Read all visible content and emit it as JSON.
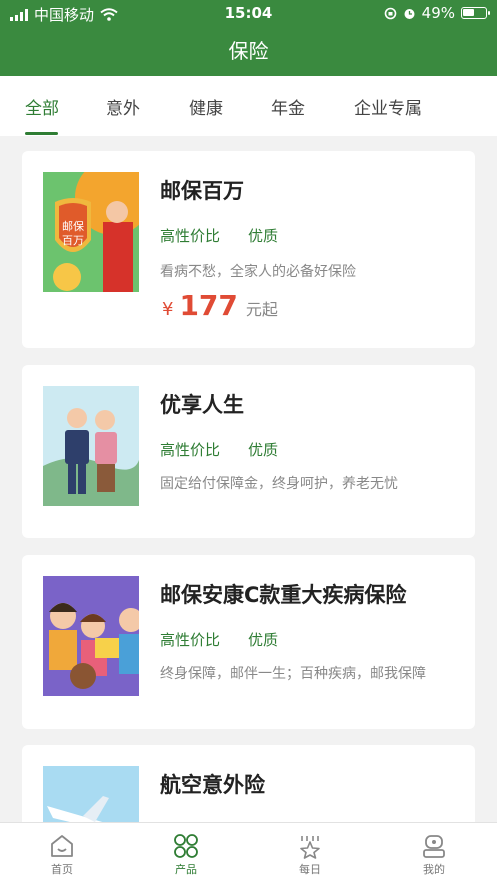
{
  "status": {
    "carrier": "中国移动",
    "time": "15:04",
    "battery": "49%"
  },
  "header": {
    "title": "保险"
  },
  "tabs": [
    "全部",
    "意外",
    "健康",
    "年金",
    "企业专属"
  ],
  "products": [
    {
      "title": "邮保百万",
      "tags": [
        "高性价比",
        "优质"
      ],
      "desc": "看病不愁，全家人的必备好保险",
      "price_currency": "¥",
      "price": "177",
      "price_suffix": "元起",
      "thumb_text": "邮保百万"
    },
    {
      "title": "优享人生",
      "tags": [
        "高性价比",
        "优质"
      ],
      "desc": "固定给付保障金，终身呵护，养老无忧"
    },
    {
      "title": "邮保安康C款重大疾病保险",
      "tags": [
        "高性价比",
        "优质"
      ],
      "desc": "终身保障，邮伴一生；百种疾病，邮我保障"
    },
    {
      "title": "航空意外险",
      "tags": [],
      "desc": ""
    }
  ],
  "tabbar": [
    {
      "label": "首页",
      "icon": "home-icon"
    },
    {
      "label": "产品",
      "icon": "products-icon",
      "active": true
    },
    {
      "label": "每日",
      "icon": "daily-star-icon"
    },
    {
      "label": "我的",
      "icon": "profile-icon"
    }
  ],
  "colors": {
    "brand": "#3a8a3f",
    "accent": "#2f7d34",
    "price": "#e04b35"
  }
}
